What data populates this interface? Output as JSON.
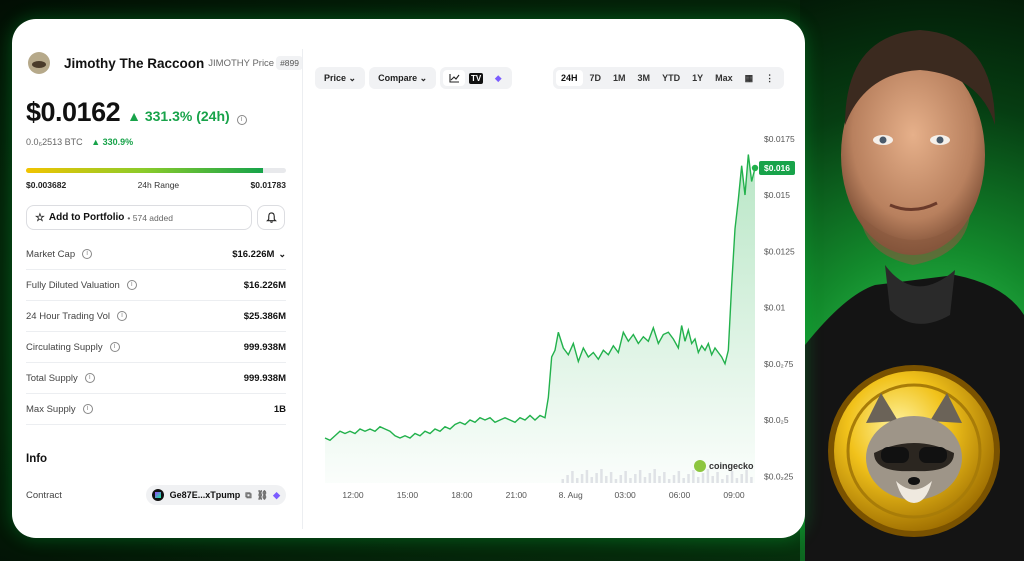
{
  "coin": {
    "name": "Jimothy The Raccoon",
    "symbol_price": "JIMOTHY Price",
    "rank": "#899",
    "price": "$0.0162",
    "change_24h": "▲ 331.3% (24h)",
    "btc_price": "0.0₆2513 BTC",
    "btc_change": "▲ 330.9%"
  },
  "range": {
    "low": "$0.003682",
    "label": "24h Range",
    "high": "$0.01783",
    "fill_fraction": 0.91
  },
  "portfolio": {
    "label": "Add to Portfolio",
    "added": "• 574 added"
  },
  "stats": [
    {
      "label": "Market Cap",
      "value": "$16.226M"
    },
    {
      "label": "Fully Diluted Valuation",
      "value": "$16.226M"
    },
    {
      "label": "24 Hour Trading Vol",
      "value": "$25.386M"
    },
    {
      "label": "Circulating Supply",
      "value": "999.938M"
    },
    {
      "label": "Total Supply",
      "value": "999.938M"
    },
    {
      "label": "Max Supply",
      "value": "1B"
    }
  ],
  "info": {
    "heading": "Info",
    "contract_label": "Contract",
    "contract_value": "Ge87E...xTpump"
  },
  "toolbar": {
    "price": "Price",
    "compare": "Compare",
    "timeframes": [
      "24H",
      "7D",
      "1M",
      "3M",
      "YTD",
      "1Y",
      "Max"
    ]
  },
  "watermark": "coingecko",
  "colors": {
    "up": "#18a34a",
    "line": "#22b14c"
  },
  "chart_data": {
    "type": "area",
    "x_labels": [
      "12:00",
      "15:00",
      "18:00",
      "21:00",
      "8. Aug",
      "03:00",
      "06:00",
      "09:00"
    ],
    "y_ticks": [
      "$0.0175",
      "$0.015",
      "$0.0125",
      "$0.01",
      "$0.0₂75",
      "$0.0₂5",
      "$0.0₂25"
    ],
    "y_tick_values": [
      0.0175,
      0.015,
      0.0125,
      0.01,
      0.0075,
      0.005,
      0.0025
    ],
    "ylim": [
      0.0022,
      0.0182
    ],
    "last_price_label": "$0.016",
    "series": [
      {
        "x": [
          0,
          0.3,
          0.6,
          0.9,
          1.2,
          1.5,
          1.8,
          2.1,
          2.4,
          2.7,
          3.0,
          3.3,
          3.6,
          3.9,
          4.2,
          4.5,
          4.8,
          5.1,
          5.4,
          5.7,
          6.0,
          6.3,
          6.6,
          6.9,
          7.2,
          7.5,
          7.8,
          8.1,
          8.4,
          8.7,
          9.0,
          9.3,
          9.6,
          9.9,
          10.2,
          10.5,
          10.8,
          11.1,
          11.4,
          11.7,
          12.0,
          12.3,
          12.6,
          12.9,
          13.2,
          13.4,
          13.6,
          13.8,
          14.0,
          14.3,
          14.6,
          14.9,
          15.2,
          15.5,
          15.8,
          16.1,
          16.4,
          16.7,
          17.0,
          17.3,
          17.6,
          17.9,
          18.2,
          18.5,
          18.8,
          19.1,
          19.4,
          19.7,
          20.0,
          20.3,
          20.6,
          20.9,
          21.2,
          21.4,
          21.6,
          21.8,
          22.0,
          22.2,
          22.4,
          22.6,
          22.8,
          23.0,
          23.2,
          23.4,
          23.6,
          23.8,
          24.0,
          24.2,
          24.4,
          24.6,
          24.8,
          25.0,
          25.2,
          25.4,
          25.6,
          25.8
        ],
        "values": [
          0.0042,
          0.0041,
          0.0043,
          0.0045,
          0.0044,
          0.0045,
          0.0044,
          0.0046,
          0.0045,
          0.0046,
          0.0045,
          0.0047,
          0.0046,
          0.0045,
          0.0043,
          0.0042,
          0.0043,
          0.0042,
          0.0044,
          0.0043,
          0.0045,
          0.0044,
          0.0046,
          0.0045,
          0.0047,
          0.0046,
          0.0048,
          0.0049,
          0.0048,
          0.005,
          0.0049,
          0.0051,
          0.005,
          0.0051,
          0.0049,
          0.005,
          0.0051,
          0.005,
          0.0049,
          0.0051,
          0.005,
          0.0052,
          0.005,
          0.0052,
          0.0051,
          0.006,
          0.0078,
          0.0081,
          0.0089,
          0.0082,
          0.0079,
          0.0084,
          0.0076,
          0.0082,
          0.0078,
          0.008,
          0.0077,
          0.0081,
          0.0079,
          0.0083,
          0.008,
          0.0089,
          0.0085,
          0.0088,
          0.0084,
          0.0087,
          0.0085,
          0.0091,
          0.0084,
          0.0088,
          0.0089,
          0.0086,
          0.0082,
          0.0092,
          0.0085,
          0.009,
          0.0084,
          0.0086,
          0.008,
          0.0083,
          0.0081,
          0.0084,
          0.0079,
          0.0082,
          0.008,
          0.0078,
          0.0075,
          0.0081,
          0.011,
          0.0135,
          0.0148,
          0.0163,
          0.015,
          0.0168,
          0.0156,
          0.0162
        ]
      }
    ]
  }
}
